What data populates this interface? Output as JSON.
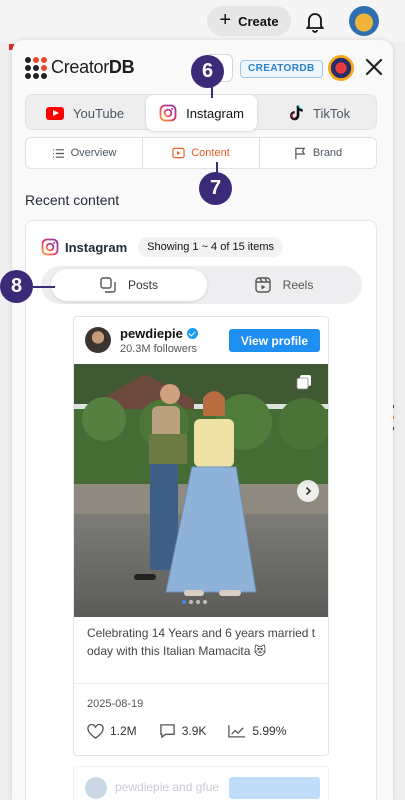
{
  "topbar": {
    "create_label": "Create"
  },
  "header": {
    "logo_text_a": "Creator",
    "logo_text_b": "DB",
    "brand_pill": "CREATORDB"
  },
  "platform_tabs": [
    {
      "label": "YouTube",
      "active": false
    },
    {
      "label": "Instagram",
      "active": true
    },
    {
      "label": "TikTok",
      "active": false
    }
  ],
  "content_tabs": [
    {
      "label": "Overview",
      "active": false
    },
    {
      "label": "Content",
      "active": true
    },
    {
      "label": "Brand",
      "active": false
    }
  ],
  "section": {
    "title": "Recent content",
    "platform": "Instagram",
    "showing": "Showing 1 ~ 4 of 15 items"
  },
  "sub_tabs": [
    {
      "label": "Posts",
      "active": true
    },
    {
      "label": "Reels",
      "active": false
    }
  ],
  "post": {
    "username": "pewdiepie",
    "followers": "20.3M followers",
    "view_profile": "View profile",
    "caption": "Celebrating 14 Years and 6 years married today with this Italian Mamacita 😻",
    "date": "2025-08-19",
    "likes": "1.2M",
    "comments": "3.9K",
    "engagement": "5.99%",
    "carousel_dots": 4,
    "active_dot": 1
  },
  "next_post": {
    "name": "pewdiepie and gfue"
  },
  "markers": [
    "6",
    "7",
    "8"
  ],
  "colors": {
    "accent": "#ec5d23",
    "marker": "#3a2a78",
    "button_blue": "#1d8ff0"
  }
}
